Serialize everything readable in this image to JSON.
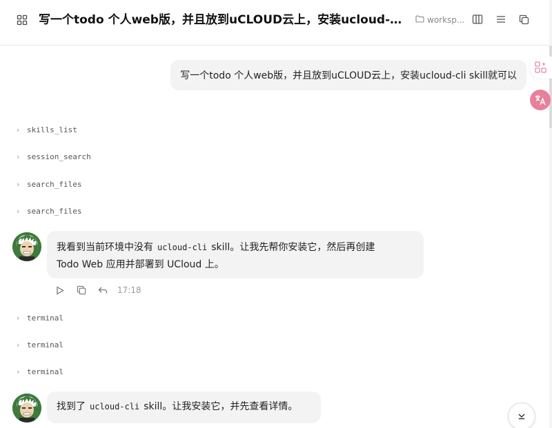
{
  "header": {
    "title": "写一个todo 个人web版，并且放到uCLOUD云上，安装ucloud-cli skill就可以",
    "workspace_label": "worksp..."
  },
  "user_message": {
    "text": "写一个todo 个人web版，并且放到uCLOUD云上，安装ucloud-cli skill就可以"
  },
  "tool_calls_1": [
    {
      "label": "skills_list"
    },
    {
      "label": "session_search"
    },
    {
      "label": "search_files"
    },
    {
      "label": "search_files"
    }
  ],
  "assistant_1": {
    "text_before": "我看到当前环境中没有",
    "code": "ucloud-cli",
    "text_after_line1": "skill。让我先帮你安装它，然后再创建",
    "text_line2": "Todo Web 应用并部署到 UCloud 上。",
    "time": "17:18"
  },
  "tool_calls_2": [
    {
      "label": "terminal"
    },
    {
      "label": "terminal"
    },
    {
      "label": "terminal"
    }
  ],
  "assistant_2": {
    "text_before": "找到了",
    "code": "ucloud-cli",
    "text_after": "skill。让我安装它，并先查看详情。"
  },
  "colors": {
    "bubble": "#f3f3f3",
    "translate_button": "#e8809a",
    "apps_icon": "#e58aa6"
  },
  "icons": {
    "header_left": "grid-icon",
    "workspace": "folder-icon",
    "panel": "columns-icon",
    "menu": "menu-icon",
    "copy": "copy-icon",
    "apps": "apps-sparkle-icon",
    "translate": "translate-icon",
    "play": "play-icon",
    "reply": "reply-icon",
    "scroll_down": "chevron-down-icon"
  }
}
